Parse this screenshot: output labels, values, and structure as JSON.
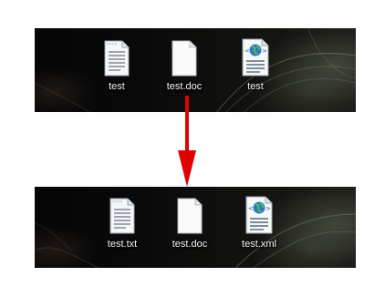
{
  "before": {
    "files": [
      {
        "name": "test",
        "icon": "text-file-icon"
      },
      {
        "name": "test.doc",
        "icon": "blank-document-icon"
      },
      {
        "name": "test",
        "icon": "xml-globe-file-icon"
      }
    ]
  },
  "after": {
    "files": [
      {
        "name": "test.txt",
        "icon": "text-file-icon"
      },
      {
        "name": "test.doc",
        "icon": "blank-document-icon"
      },
      {
        "name": "test.xml",
        "icon": "xml-globe-file-icon"
      }
    ]
  },
  "colors": {
    "arrow": "#e00000",
    "label": "#f2f2f2"
  }
}
